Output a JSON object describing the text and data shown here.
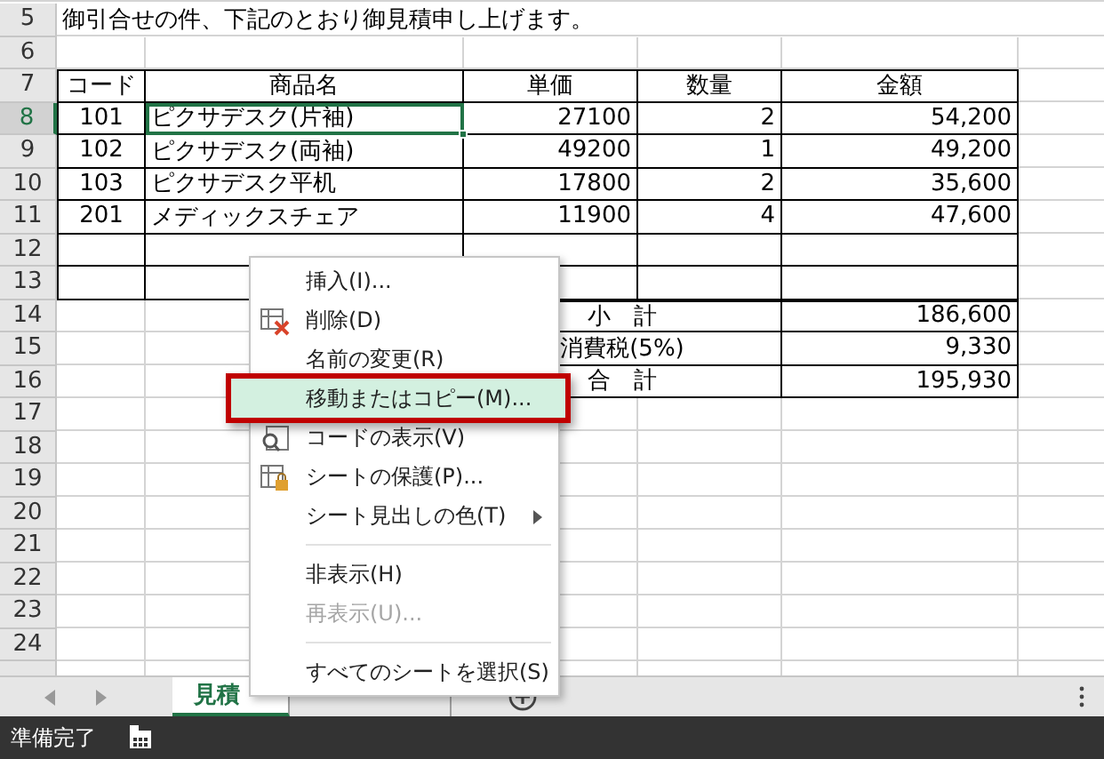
{
  "row_headers": [
    {
      "label": "5",
      "selected": false
    },
    {
      "label": "6",
      "selected": false
    },
    {
      "label": "7",
      "selected": false
    },
    {
      "label": "8",
      "selected": true
    },
    {
      "label": "9",
      "selected": false
    },
    {
      "label": "10",
      "selected": false
    },
    {
      "label": "11",
      "selected": false
    },
    {
      "label": "12",
      "selected": false
    },
    {
      "label": "13",
      "selected": false
    },
    {
      "label": "14",
      "selected": false
    },
    {
      "label": "15",
      "selected": false
    },
    {
      "label": "16",
      "selected": false
    },
    {
      "label": "17",
      "selected": false
    },
    {
      "label": "18",
      "selected": false
    },
    {
      "label": "19",
      "selected": false
    },
    {
      "label": "20",
      "selected": false
    },
    {
      "label": "21",
      "selected": false
    },
    {
      "label": "22",
      "selected": false
    },
    {
      "label": "23",
      "selected": false
    },
    {
      "label": "24",
      "selected": false
    }
  ],
  "intro": "御引合せの件、下記のとおり御見積申し上げます。",
  "table": {
    "columns": [
      "コード",
      "商品名",
      "単価",
      "数量",
      "金額"
    ],
    "rows": [
      {
        "code": "101",
        "name": "ピクサデスク(片袖)",
        "price": "27100",
        "qty": "2",
        "amount": "54,200",
        "selected": true
      },
      {
        "code": "102",
        "name": "ピクサデスク(両袖)",
        "price": "49200",
        "qty": "1",
        "amount": "49,200",
        "selected": false
      },
      {
        "code": "103",
        "name": "ピクサデスク平机",
        "price": "17800",
        "qty": "2",
        "amount": "35,600",
        "selected": false
      },
      {
        "code": "201",
        "name": "メディックスチェア",
        "price": "11900",
        "qty": "4",
        "amount": "47,600",
        "selected": false
      }
    ]
  },
  "totals": [
    {
      "label": "小　計",
      "value": "186,600"
    },
    {
      "label": "消費税(5%)",
      "value": "9,330"
    },
    {
      "label": "合　計",
      "value": "195,930"
    }
  ],
  "context_menu": [
    {
      "kind": "item",
      "label": "挿入(I)...",
      "selected": false,
      "disabled": false
    },
    {
      "kind": "delete",
      "label": "削除(D)",
      "selected": false,
      "disabled": false
    },
    {
      "kind": "item",
      "label": "名前の変更(R)",
      "selected": false,
      "disabled": false
    },
    {
      "kind": "item",
      "label": "移動またはコピー(M)...",
      "selected": true,
      "disabled": false
    },
    {
      "kind": "code",
      "label": "コードの表示(V)",
      "selected": false,
      "disabled": false
    },
    {
      "kind": "protect",
      "label": "シートの保護(P)...",
      "selected": false,
      "disabled": false
    },
    {
      "kind": "submenu",
      "label": "シート見出しの色(T)",
      "selected": false,
      "disabled": false
    },
    {
      "kind": "separator"
    },
    {
      "kind": "item",
      "label": "非表示(H)",
      "selected": false,
      "disabled": false
    },
    {
      "kind": "item",
      "label": "再表示(U)...",
      "selected": false,
      "disabled": true
    },
    {
      "kind": "separator"
    },
    {
      "kind": "item",
      "label": "すべてのシートを選択(S)",
      "selected": false,
      "disabled": false
    }
  ],
  "sheet_tabs": [
    {
      "label": "見積",
      "selected": true
    },
    {
      "selected": false
    }
  ],
  "status_bar": {
    "text": "準備完了"
  }
}
